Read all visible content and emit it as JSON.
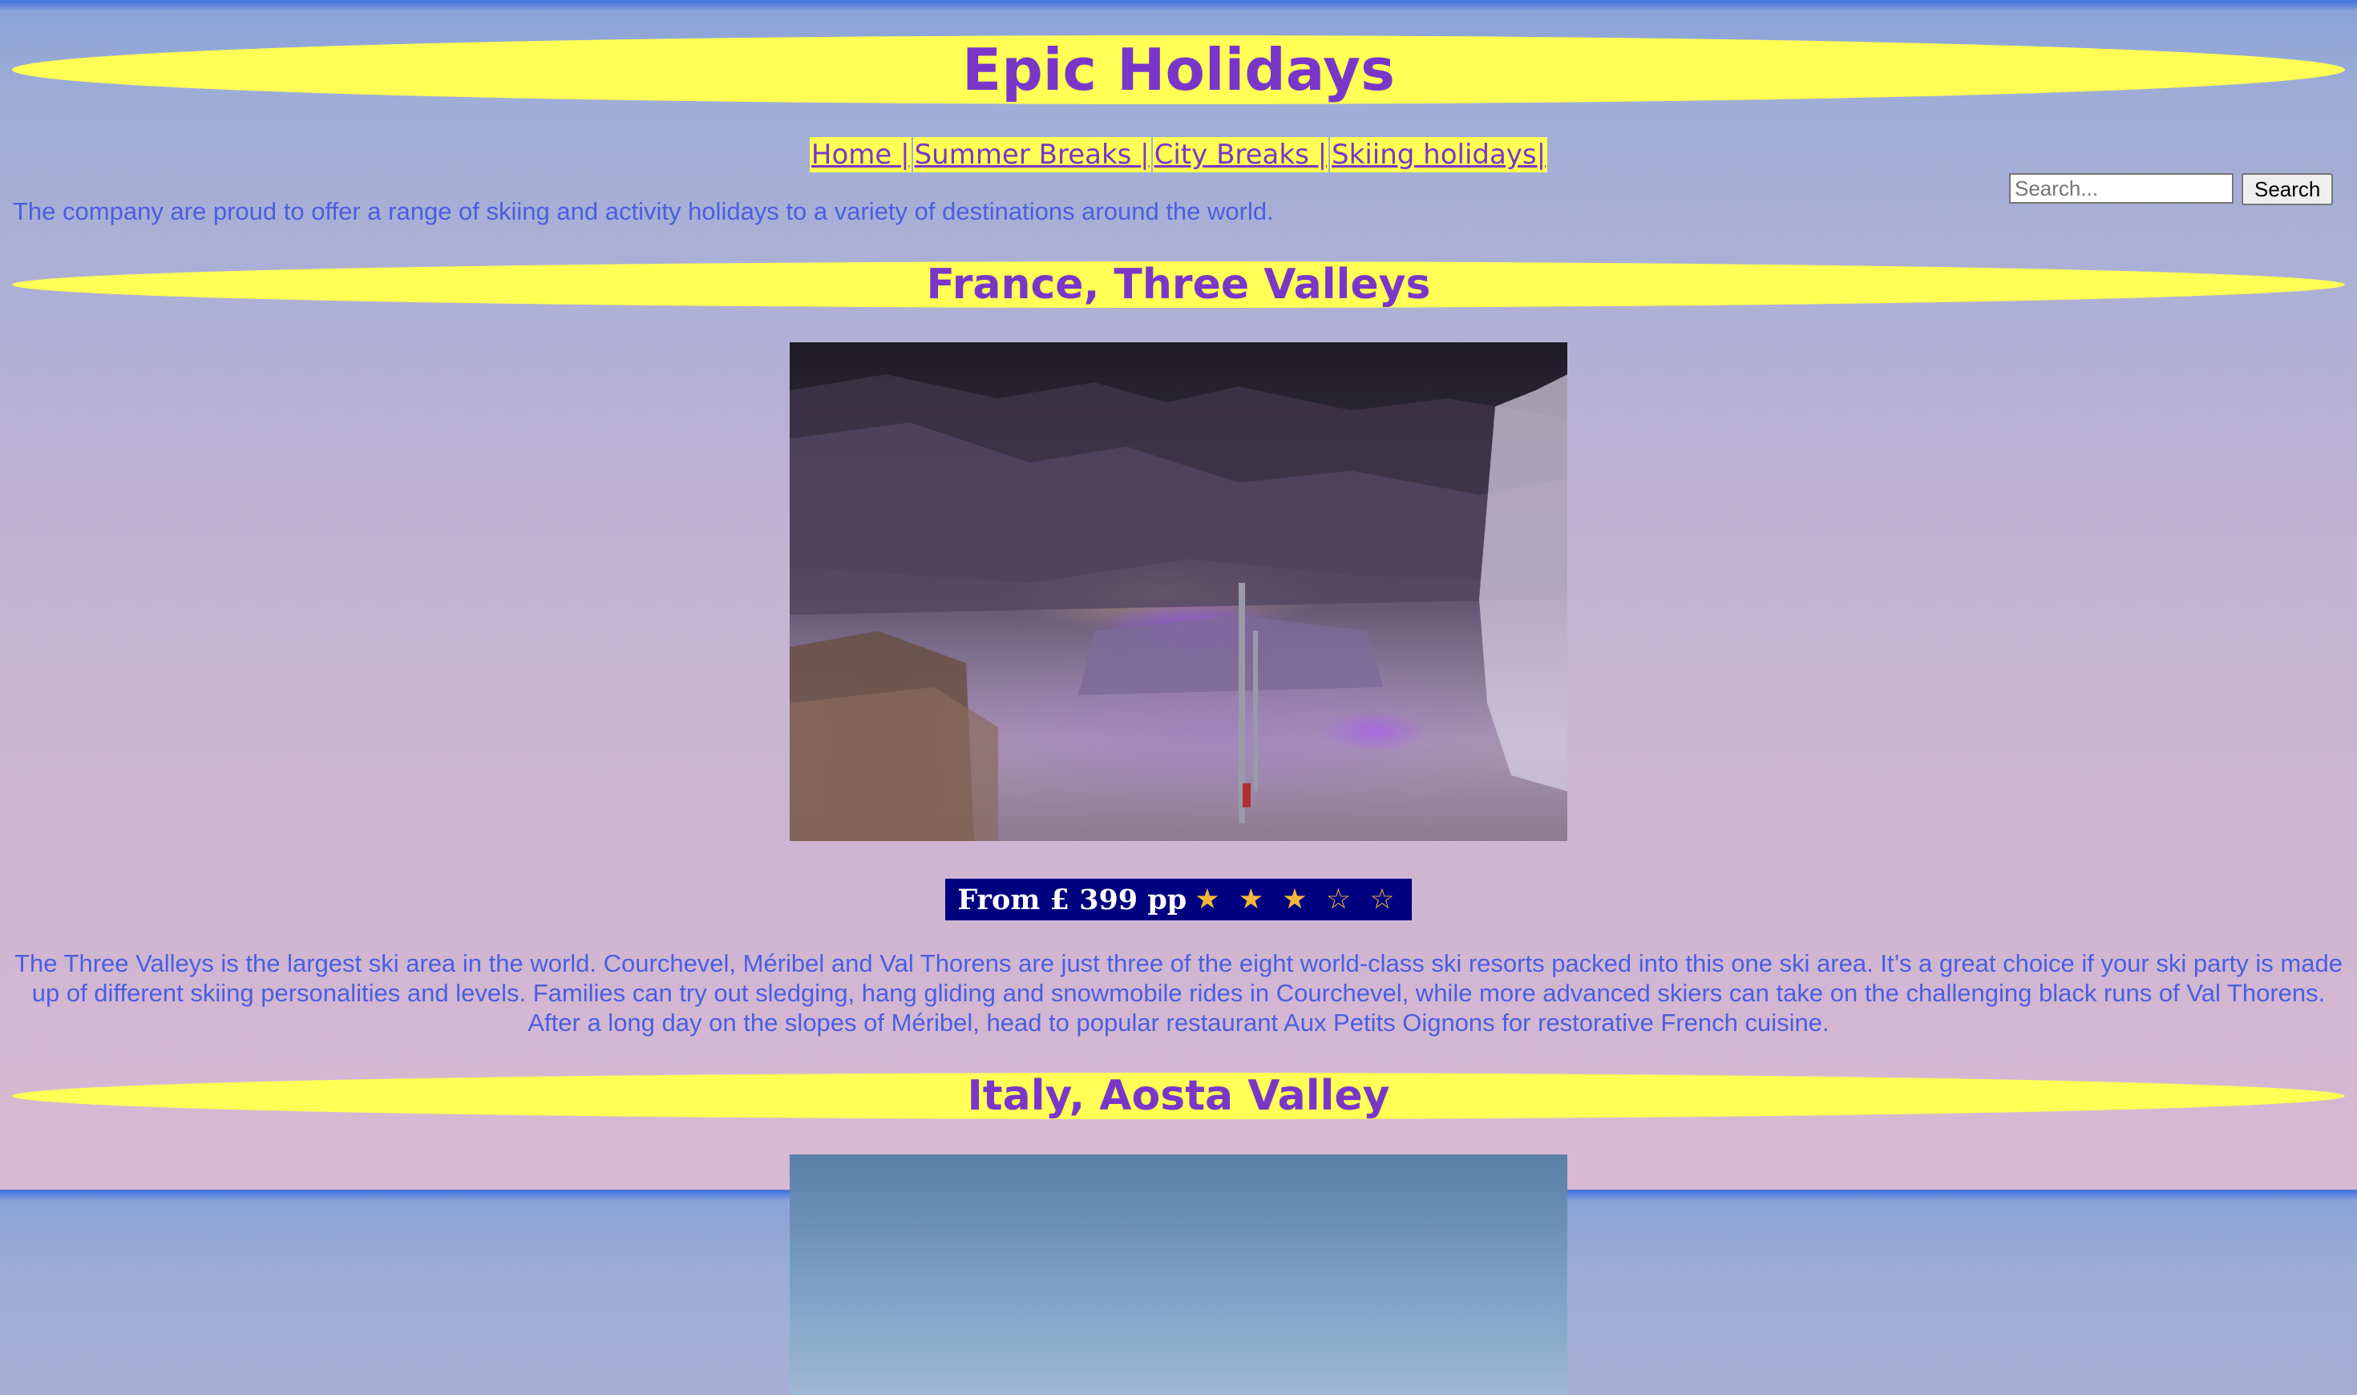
{
  "site": {
    "title": "Epic Holidays",
    "intro": "The company are proud to offer a range of skiing and activity holidays to a variety of destinations around the world."
  },
  "nav": {
    "items": [
      {
        "label": "Home |"
      },
      {
        "label": "Summer Breaks |"
      },
      {
        "label": "City Breaks |"
      },
      {
        "label": "Skiing holidays|"
      }
    ]
  },
  "search": {
    "placeholder": "Search...",
    "button_label": "Search"
  },
  "destinations": [
    {
      "heading": "France, Three Valleys",
      "price": "From £ 399 pp",
      "rating": 3,
      "rating_max": 5,
      "stars_text": "★ ★ ★ ☆ ☆",
      "description": "The Three Valleys is the largest ski area in the world. Courchevel, Méribel and Val Thorens are just three of the eight world-class ski resorts packed into this one ski area. It’s a great choice if your ski party is made up of different skiing personalities and levels. Families can try out sledging, hang gliding and snowmobile rides in Courchevel, while more advanced skiers can take on the challenging black runs of Val Thorens. After a long day on the slopes of Méribel, head to popular restaurant Aux Petits Oignons for restorative French cuisine."
    },
    {
      "heading": "Italy, Aosta Valley"
    }
  ],
  "colors": {
    "banner_bg": "#ffff55",
    "heading_text": "#7a36c9",
    "body_text": "#4a5fe0",
    "price_bg": "#000080",
    "star": "#f5b73a"
  }
}
